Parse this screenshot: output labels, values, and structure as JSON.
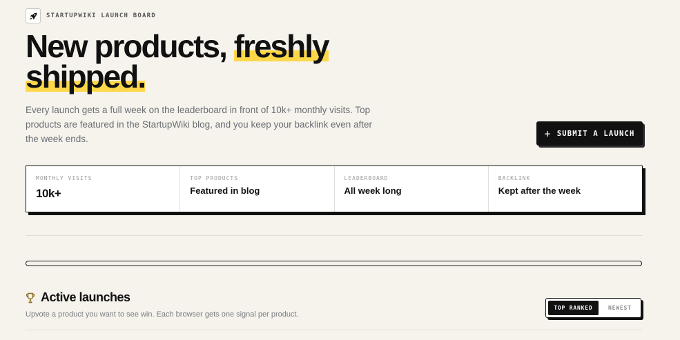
{
  "brand": {
    "name": "STARTUPWIKI LAUNCH BOARD",
    "logo_icon": "rocket-icon"
  },
  "hero": {
    "line1_plain": "New products,",
    "line1_highlight": "freshly",
    "line2_highlight": "shipped."
  },
  "description": "Every launch gets a full week on the leaderboard in front of 10k+ monthly visits. Top products are featured in the StartupWiki blog, and you keep your backlink even after the week ends.",
  "submit_button": {
    "icon": "+",
    "label": "SUBMIT A LAUNCH"
  },
  "stats": [
    {
      "label": "MONTHLY VISITS",
      "value": "10k+"
    },
    {
      "label": "TOP PRODUCTS",
      "value": "Featured in blog"
    },
    {
      "label": "LEADERBOARD",
      "value": "All week long"
    },
    {
      "label": "BACKLINK",
      "value": "Kept after the week"
    }
  ],
  "progress": {
    "fraction": 0
  },
  "active_launches": {
    "icon": "trophy-icon",
    "title": "Active launches",
    "subtitle": "Upvote a product you want to see win. Each browser gets one signal per product."
  },
  "sort_toggle": {
    "options": [
      "TOP RANKED",
      "NEWEST"
    ],
    "selected": "TOP RANKED"
  },
  "colors": {
    "background": "#f5f3ec",
    "highlight": "#ffd84a",
    "ink": "#111111"
  }
}
